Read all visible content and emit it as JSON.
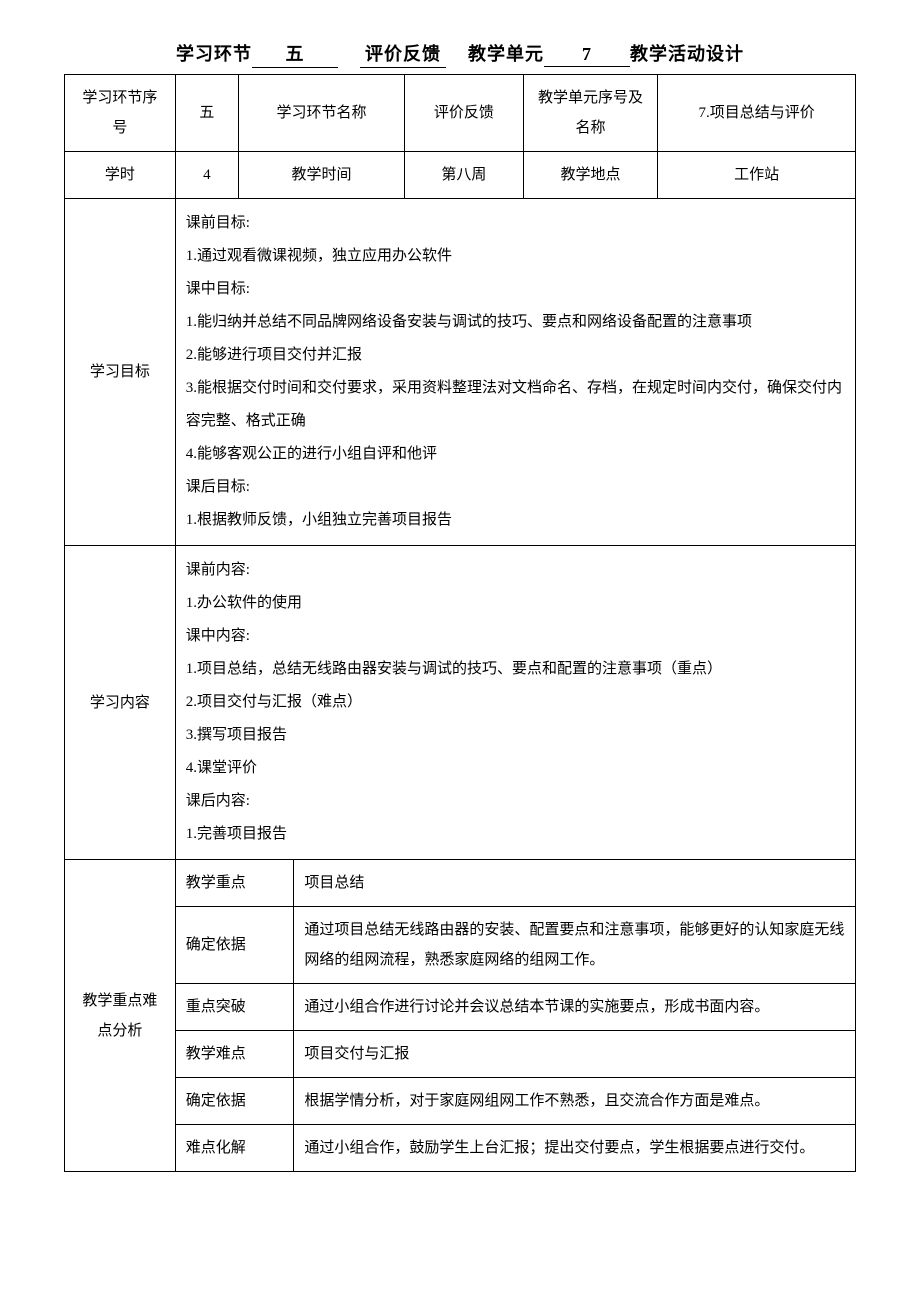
{
  "title": {
    "pre": "学习环节",
    "stage_no": "五",
    "gap": "    ",
    "stage_name": "评价反馈",
    "mid": "    教学单元",
    "unit_no": "7",
    "post": "教学活动设计"
  },
  "header": {
    "row1": {
      "c1": "学习环节序号",
      "c2": "五",
      "c3": "学习环节名称",
      "c4": "评价反馈",
      "c5": "教学单元序号及名称",
      "c6": "7.项目总结与评价"
    },
    "row2": {
      "c1": "学时",
      "c2": "4",
      "c3": "教学时间",
      "c4": "第八周",
      "c5": "教学地点",
      "c6": "工作站"
    }
  },
  "objectives": {
    "label": "学习目标",
    "pre_title": "课前目标:",
    "pre_1": "1.通过观看微课视频，独立应用办公软件",
    "in_title": "课中目标:",
    "in_1": "1.能归纳并总结不同品牌网络设备安装与调试的技巧、要点和网络设备配置的注意事项",
    "in_2": "2.能够进行项目交付并汇报",
    "in_3": "3.能根据交付时间和交付要求，采用资料整理法对文档命名、存档，在规定时间内交付，确保交付内容完整、格式正确",
    "in_4": "4.能够客观公正的进行小组自评和他评",
    "post_title": "课后目标:",
    "post_1": "1.根据教师反馈，小组独立完善项目报告"
  },
  "contents": {
    "label": "学习内容",
    "pre_title": "课前内容:",
    "pre_1": "1.办公软件的使用",
    "in_title": "课中内容:",
    "in_1": "1.项目总结，总结无线路由器安装与调试的技巧、要点和配置的注意事项（重点）",
    "in_2": "2.项目交付与汇报（难点）",
    "in_3": "3.撰写项目报告",
    "in_4": "4.课堂评价",
    "post_title": "课后内容:",
    "post_1": "1.完善项目报告"
  },
  "analysis": {
    "label": "教学重点难点分析",
    "rows": {
      "r1a": "教学重点",
      "r1b": "项目总结",
      "r2a": "确定依据",
      "r2b": "通过项目总结无线路由器的安装、配置要点和注意事项，能够更好的认知家庭无线网络的组网流程，熟悉家庭网络的组网工作。",
      "r3a": "重点突破",
      "r3b": "通过小组合作进行讨论并会议总结本节课的实施要点，形成书面内容。",
      "r4a": "教学难点",
      "r4b": "项目交付与汇报",
      "r5a": "确定依据",
      "r5b": "根据学情分析，对于家庭网组网工作不熟悉，且交流合作方面是难点。",
      "r6a": "难点化解",
      "r6b": "通过小组合作，鼓励学生上台汇报；提出交付要点，学生根据要点进行交付。"
    }
  }
}
